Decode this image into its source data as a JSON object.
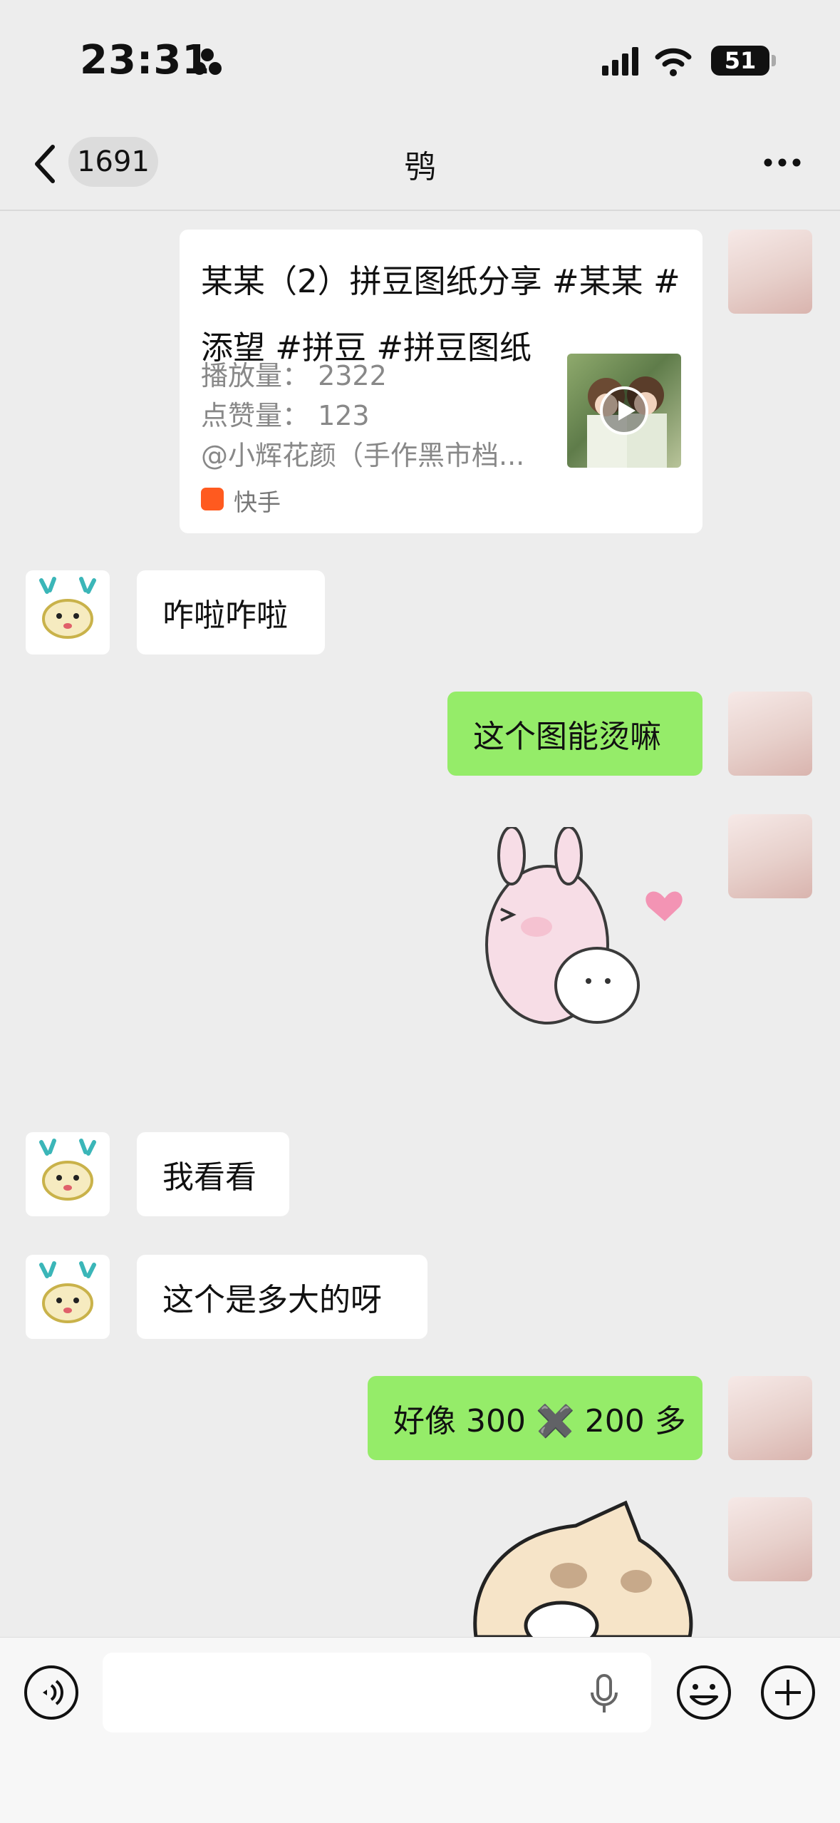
{
  "status_bar": {
    "time": "23:31",
    "battery": "51"
  },
  "nav": {
    "unread_count": "1691",
    "title": "鸮"
  },
  "share_card": {
    "title": "某某（2）拼豆图纸分享 #某某 #添望 #拼豆 #拼豆图纸",
    "plays": "播放量：  2322",
    "likes": "点赞量：  123",
    "author": "@小辉花颜（手作黑市档...",
    "source": "快手"
  },
  "messages": [
    {
      "side": "in",
      "text": "咋啦咋啦"
    },
    {
      "side": "out",
      "text": "这个图能烫嘛"
    },
    {
      "side": "out",
      "type": "sticker",
      "icon": "bunny-hug-sticker"
    },
    {
      "side": "in",
      "text": "我看看"
    },
    {
      "side": "in",
      "text": "这个是多大的呀"
    },
    {
      "side": "out",
      "text": "好像 300 ✖️ 200 多"
    },
    {
      "side": "out",
      "type": "sticker",
      "icon": "puppy-sticker"
    }
  ],
  "colors": {
    "bubble_out": "#95ec69",
    "bubble_in": "#ffffff",
    "background": "#ededed",
    "kuaishou_brand": "#ff5a1f"
  },
  "icons": {
    "back": "chevron-left-icon",
    "more": "more-dots-icon",
    "voice": "voice-icon",
    "mic": "microphone-icon",
    "emoji": "emoji-icon",
    "plus": "plus-icon",
    "play": "play-icon"
  }
}
